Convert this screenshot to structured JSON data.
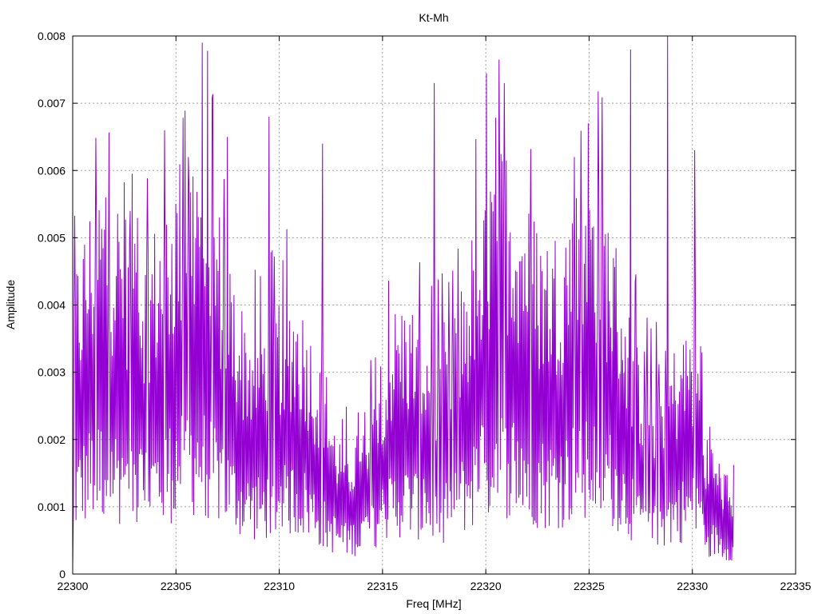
{
  "chart_data": {
    "type": "line",
    "title": "Kt-Mh",
    "xlabel": "Freq [MHz]",
    "ylabel": "Amplitude",
    "xlim": [
      22300,
      22335
    ],
    "ylim": [
      0,
      0.008
    ],
    "x_ticks": [
      22300,
      22305,
      22310,
      22315,
      22320,
      22325,
      22330,
      22335
    ],
    "y_ticks": [
      0,
      0.001,
      0.002,
      0.003,
      0.004,
      0.005,
      0.006,
      0.007,
      0.008
    ],
    "x_tick_labels": [
      "22300",
      "22305",
      "22310",
      "22315",
      "22320",
      "22325",
      "22330",
      "22335"
    ],
    "y_tick_labels": [
      "0",
      "0.001",
      "0.002",
      "0.003",
      "0.004",
      "0.005",
      "0.006",
      "0.007",
      "0.008"
    ],
    "grid": true,
    "legend": "none",
    "series": [
      {
        "color": "#9400d3",
        "x_start": 22300,
        "x_end": 22332,
        "points": 1000,
        "description_peaks": [
          [
            22301.6,
            0.0056
          ],
          [
            22302.8,
            0.0054
          ],
          [
            22305.6,
            0.0062
          ],
          [
            22307.5,
            0.0065
          ],
          [
            22309.5,
            0.0068
          ],
          [
            22312.1,
            0.0064
          ],
          [
            22317.5,
            0.0073
          ],
          [
            22320.9,
            0.0073
          ],
          [
            22324.3,
            0.0062
          ],
          [
            22327.0,
            0.0078
          ],
          [
            22328.8,
            0.008
          ],
          [
            22330.1,
            0.0063
          ]
        ]
      }
    ]
  }
}
